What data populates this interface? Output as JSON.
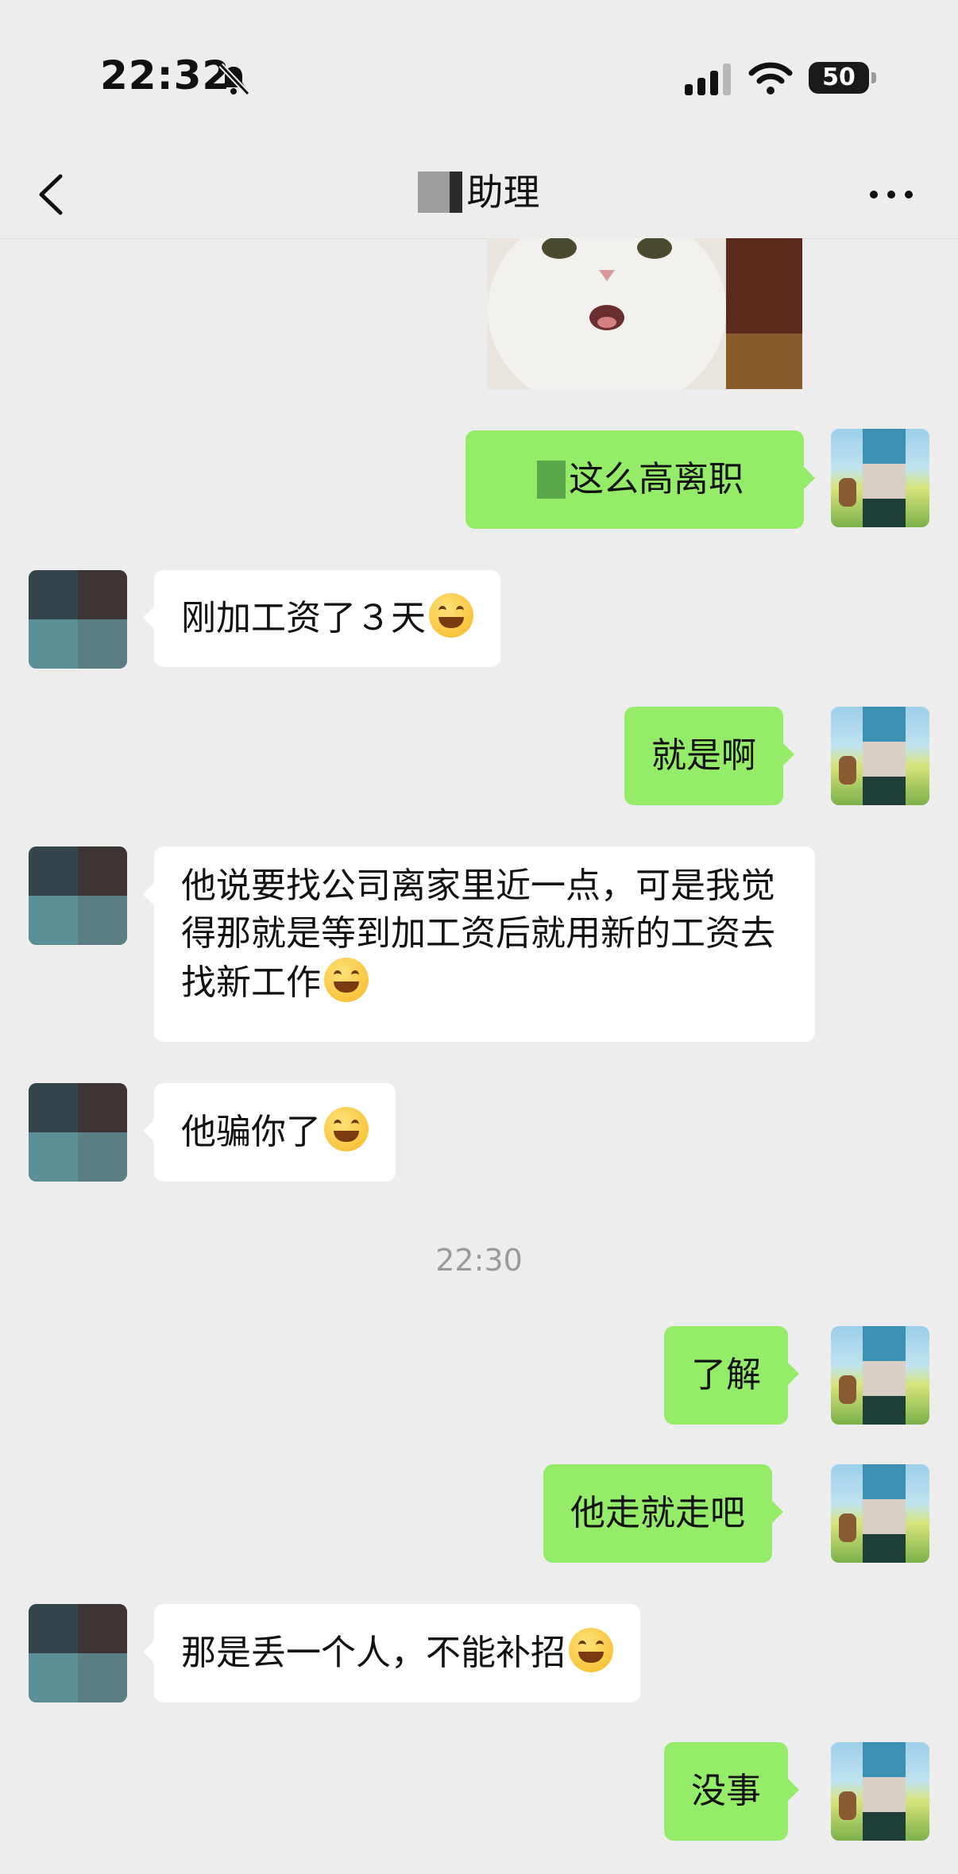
{
  "status_bar": {
    "time": "22:32",
    "battery": "50"
  },
  "header": {
    "title": "助理"
  },
  "messages": {
    "m1": {
      "text": "这么高离职"
    },
    "m2": {
      "text": "刚加工资了３天"
    },
    "m3": {
      "text": "就是啊"
    },
    "m4": {
      "text": "他说要找公司离家里近一点，可是我觉得那就是等到加工资后就用新的工资去找新工作"
    },
    "m5": {
      "text": "他骗你了"
    },
    "timestamp": "22:30",
    "m6": {
      "text": "了解"
    },
    "m7": {
      "text": "他走就走吧"
    },
    "m8": {
      "text": "那是丢一个人，不能补招"
    },
    "m9": {
      "text": "没事"
    }
  },
  "icons": {
    "mute": "bell-slash-icon",
    "back": "chevron-left-icon",
    "more": "more-dots-icon"
  },
  "colors": {
    "background": "#ededed",
    "incoming_bubble": "#ffffff",
    "outgoing_bubble": "#95ec69",
    "timestamp": "#9a9a9a"
  }
}
